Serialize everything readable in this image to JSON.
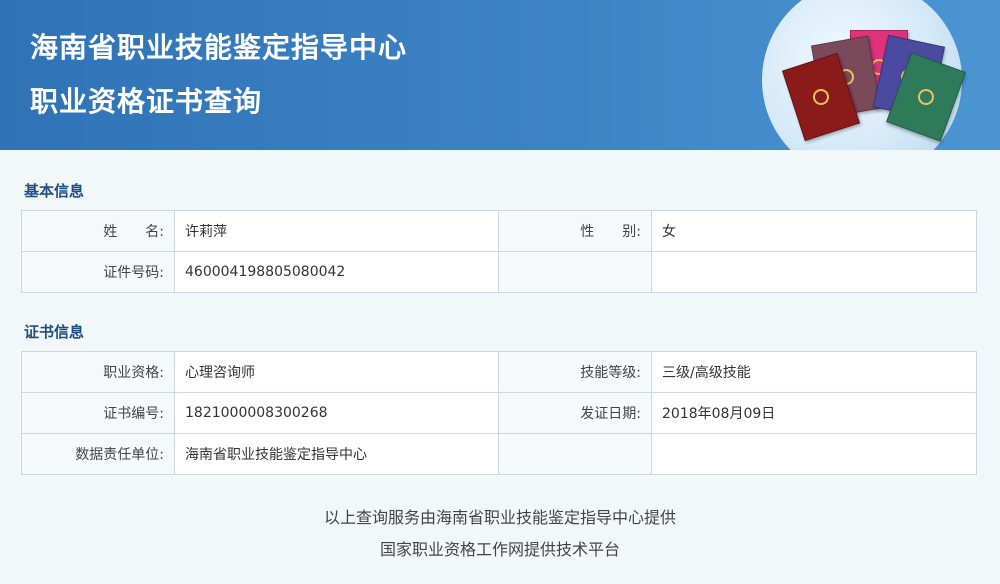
{
  "banner": {
    "title": "海南省职业技能鉴定指导中心",
    "subtitle": "职业资格证书查询"
  },
  "basic": {
    "heading": "基本信息",
    "name_label": "姓　　名:",
    "name_value": "许莉萍",
    "gender_label": "性　　别:",
    "gender_value": "女",
    "id_label": "证件号码:",
    "id_value": "460004198805080042"
  },
  "cert": {
    "heading": "证书信息",
    "qual_label": "职业资格:",
    "qual_value": "心理咨询师",
    "level_label": "技能等级:",
    "level_value": "三级/高级技能",
    "number_label": "证书编号:",
    "number_value": "1821000008300268",
    "date_label": "发证日期:",
    "date_value": "2018年08月09日",
    "unit_label": "数据责任单位:",
    "unit_value": "海南省职业技能鉴定指导中心"
  },
  "footer": {
    "line1": "以上查询服务由海南省职业技能鉴定指导中心提供",
    "line2": "国家职业资格工作网提供技术平台"
  },
  "colors": {
    "banner": "#3c83c5",
    "heading": "#1e4e85",
    "books": [
      "#8b1a1a",
      "#7a4a5a",
      "#e0327a",
      "#4a4aa0",
      "#2f7a5a"
    ]
  }
}
